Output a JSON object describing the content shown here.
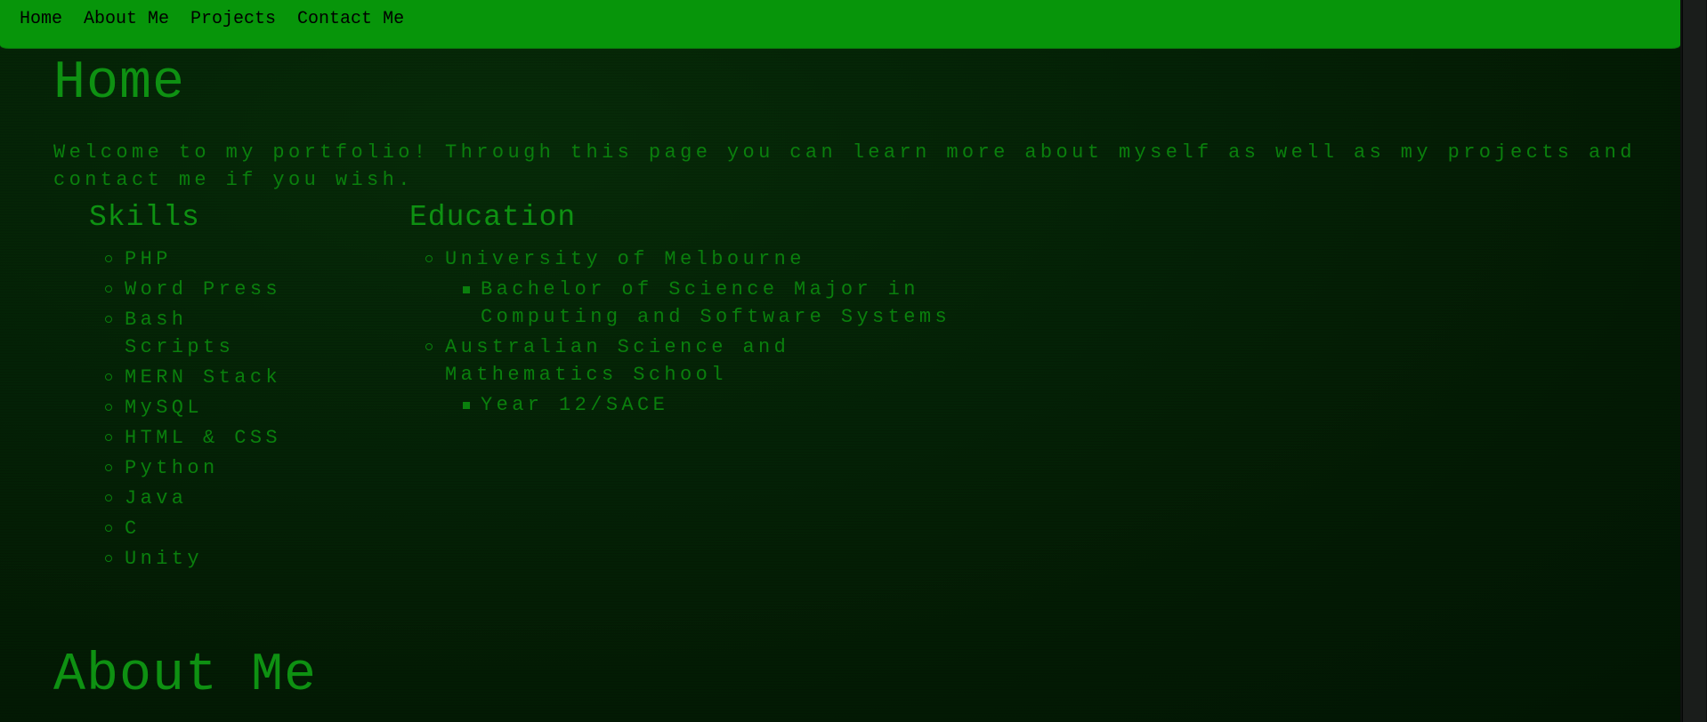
{
  "nav": {
    "items": [
      {
        "label": "Home"
      },
      {
        "label": "About Me"
      },
      {
        "label": "Projects"
      },
      {
        "label": "Contact Me"
      }
    ]
  },
  "home": {
    "title": "Home",
    "intro": "Welcome to my portfolio! Through this page you can learn more about myself as well as my projects and contact me if you wish."
  },
  "skills": {
    "title": "Skills",
    "items": [
      "PHP",
      "Word Press",
      "Bash Scripts",
      "MERN Stack",
      "MySQL",
      "HTML & CSS",
      "Python",
      "Java",
      "C",
      "Unity"
    ]
  },
  "education": {
    "title": "Education",
    "items": [
      {
        "label": "University of Melbourne",
        "sub": [
          "Bachelor of Science Major in Computing and Software Systems"
        ]
      },
      {
        "label": "Australian Science and Mathematics School",
        "sub": [
          "Year 12/SACE"
        ]
      }
    ]
  },
  "about": {
    "title": "About Me"
  },
  "colors": {
    "navbar": "#07950a",
    "background": "#031d04",
    "text": "#0a7f0d",
    "heading": "#0e9112"
  }
}
